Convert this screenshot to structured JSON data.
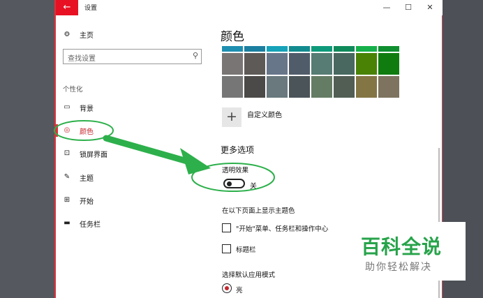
{
  "window": {
    "title": "设置",
    "back_glyph": "←",
    "minimize_glyph": "—",
    "maximize_glyph": "☐",
    "close_glyph": "✕"
  },
  "sidebar": {
    "home_label": "主页",
    "search_placeholder": "查找设置",
    "section_heading": "个性化",
    "items": [
      {
        "label": "背景",
        "icon": "picture-icon",
        "glyph": "▭"
      },
      {
        "label": "颜色",
        "icon": "palette-icon",
        "glyph": "◎"
      },
      {
        "label": "锁屏界面",
        "icon": "lock-screen-icon",
        "glyph": "⊡"
      },
      {
        "label": "主题",
        "icon": "theme-icon",
        "glyph": "✎"
      },
      {
        "label": "开始",
        "icon": "start-icon",
        "glyph": "⊞"
      },
      {
        "label": "任务栏",
        "icon": "taskbar-icon",
        "glyph": "▬"
      }
    ],
    "active_index": 1
  },
  "main": {
    "heading": "颜色",
    "accent_strip": [
      "#1e8fb0",
      "#1b7fa0",
      "#16a2b8",
      "#128b8f",
      "#0e9a7a",
      "#0f8a5a",
      "#16b04a",
      "#0f8f30"
    ],
    "swatches_row1": [
      "#7a7575",
      "#5d5a58",
      "#68768a",
      "#515c6b",
      "#567c73",
      "#486860",
      "#498205",
      "#107c10"
    ],
    "swatches_row2": [
      "#767676",
      "#4c4a48",
      "#69797e",
      "#4a5459",
      "#647c64",
      "#525e54",
      "#847545",
      "#7e735f"
    ],
    "custom_color_label": "自定义颜色",
    "more_options_heading": "更多选项",
    "transparency_label": "透明效果",
    "transparency_state": "关",
    "show_accent_label": "在以下页面上显示主题色",
    "checkbox_start_label": "\"开始\"菜单、任务栏和操作中心",
    "checkbox_titlebar_label": "标题栏",
    "app_mode_label": "选择默认应用模式",
    "radio_light_label": "亮"
  },
  "watermark": {
    "main": "百科全说",
    "sub": "助你轻松解决"
  },
  "colors": {
    "accent_red": "#e81123",
    "annotation_green": "#2db04b"
  }
}
